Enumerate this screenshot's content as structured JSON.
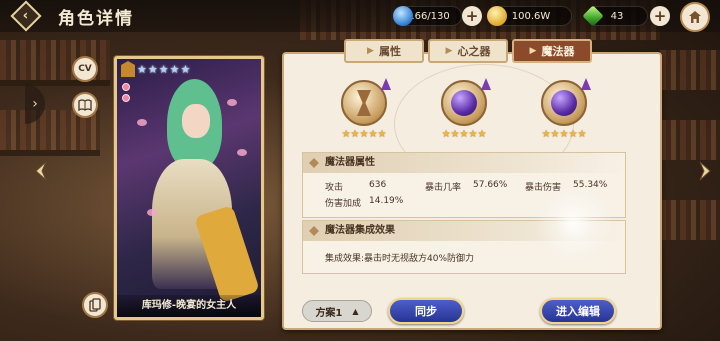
{
  "header": {
    "title": "角色详情",
    "stamina": "166/130",
    "gold": "100.6W",
    "gems": "43"
  },
  "side": {
    "cv_label": "CV"
  },
  "card": {
    "name": "库玛修-晚宴的女主人",
    "stars": "★★★★★"
  },
  "tabs": [
    {
      "label": "属性",
      "active": false
    },
    {
      "label": "心之器",
      "active": false
    },
    {
      "label": "魔法器",
      "active": true
    }
  ],
  "relics": [
    {
      "stars": "★★★★★",
      "icon": "hourglass-icon"
    },
    {
      "stars": "★★★★★",
      "icon": "purple-orb-icon"
    },
    {
      "stars": "★★★★★",
      "icon": "purple-orb-icon"
    }
  ],
  "attributes": {
    "title": "魔法器属性",
    "stats": [
      {
        "label": "攻击",
        "value": "636"
      },
      {
        "label": "暴击几率",
        "value": "57.66%"
      },
      {
        "label": "暴击伤害",
        "value": "55.34%"
      },
      {
        "label": "伤害加成",
        "value": "14.19%"
      }
    ]
  },
  "set_effect": {
    "title": "魔法器集成效果",
    "text": "集成效果:暴击时无视敌方40%防御力"
  },
  "footer": {
    "scheme_label": "方案1",
    "sync_label": "同步",
    "edit_label": "进入编辑"
  },
  "colors": {
    "active_tab": "#8a4a2b",
    "button_blue": "#2f3fa8",
    "star_gold": "#f0b634"
  }
}
